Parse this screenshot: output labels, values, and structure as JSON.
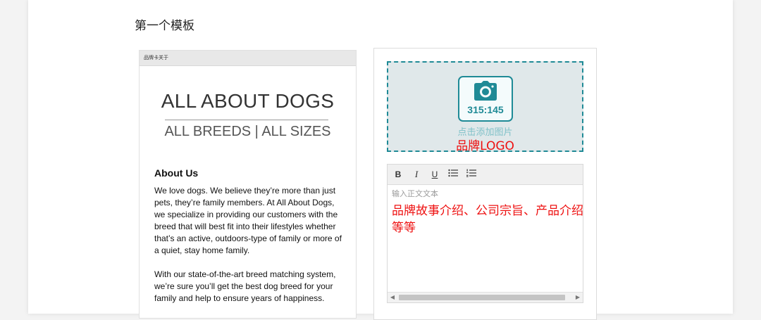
{
  "section_title": "第一个模板",
  "preview": {
    "header": "品牌卡关于",
    "brand_title": "ALL ABOUT DOGS",
    "brand_subtitle": "ALL BREEDS | ALL SIZES",
    "about_heading": "About Us",
    "paragraph_1": "We love dogs. We believe they’re more than just pets, they’re family members. At All About Dogs, we specialize in providing our customers with the breed that will best fit into their lifestyles whether that’s an active, outdoors-type of family or more of a quiet, stay home family.",
    "paragraph_2": "With our state-of-the-art breed matching system, we’re sure you’ll get the best dog breed for your family and help to ensure years of happiness."
  },
  "editor": {
    "logo": {
      "icon": "camera-icon",
      "ratio": "315:145",
      "add_picture": "点击添加图片",
      "label": "品牌LOGO"
    },
    "toolbar": {
      "bold": "B",
      "italic": "I",
      "underline": "U"
    },
    "body_placeholder": "输入正文文本",
    "body_note": "品牌故事介绍、公司宗旨、产品介绍等等"
  },
  "colors": {
    "accent": "#1f8a96",
    "annotation": "#ee1111"
  }
}
